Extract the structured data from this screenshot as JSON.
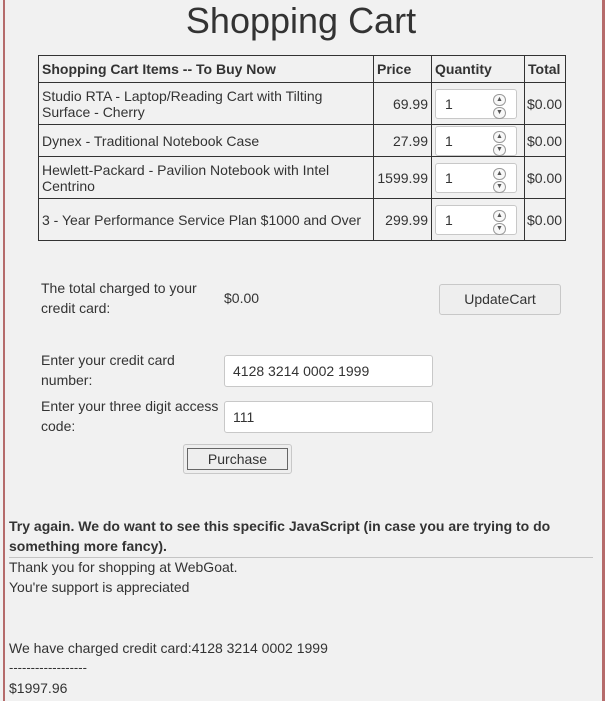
{
  "page": {
    "title": "Shopping Cart"
  },
  "cart": {
    "headers": {
      "item": "Shopping Cart Items -- To Buy Now",
      "price": "Price",
      "quantity": "Quantity",
      "total": "Total"
    },
    "items": [
      {
        "name": "Studio RTA - Laptop/Reading Cart with Tilting Surface - Cherry",
        "price": "69.99",
        "quantity": "1",
        "total": "$0.00"
      },
      {
        "name": "Dynex - Traditional Notebook Case",
        "price": "27.99",
        "quantity": "1",
        "total": "$0.00"
      },
      {
        "name": "Hewlett-Packard - Pavilion Notebook with Intel Centrino",
        "price": "1599.99",
        "quantity": "1",
        "total": "$0.00"
      },
      {
        "name": "3 - Year Performance Service Plan $1000 and Over",
        "price": "299.99",
        "quantity": "1",
        "total": "$0.00"
      }
    ]
  },
  "summary": {
    "total_label": "The total charged to your credit card:",
    "total_value": "$0.00",
    "update_button": "UpdateCart"
  },
  "payment": {
    "card_label": "Enter your credit card number:",
    "card_value": "4128 3214 0002 1999",
    "code_label": "Enter your three digit access code:",
    "code_value": "111",
    "purchase_button": "Purchase"
  },
  "result": {
    "message": "Try again. We do want to see this specific JavaScript (in case you are trying to do something more fancy).",
    "thanks": "Thank you for shopping at WebGoat.",
    "appreciated": "You're support is appreciated",
    "charged": "We have charged credit card:4128 3214 0002 1999",
    "separator": "------------------",
    "amount": "$1997.96"
  },
  "icons": {
    "spin_up": "chevron-up-icon",
    "spin_down": "chevron-down-icon"
  },
  "colors": {
    "frame": "#b56b6b",
    "background": "#f1f1f1",
    "text": "#333333"
  }
}
